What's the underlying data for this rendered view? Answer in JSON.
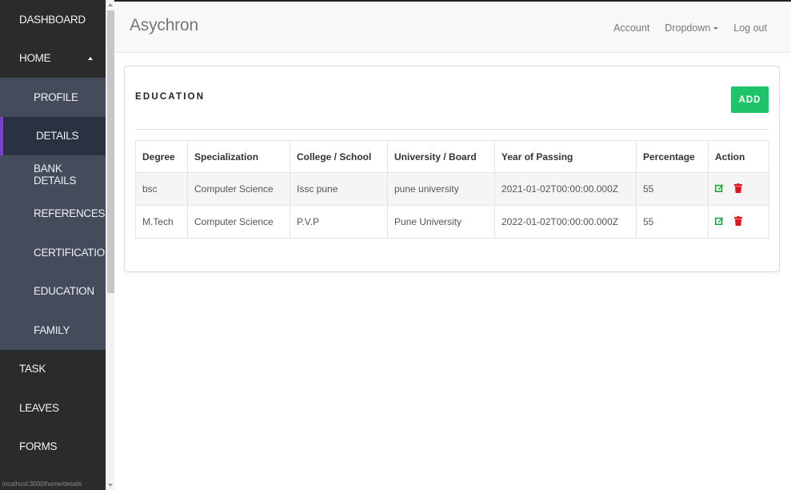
{
  "sidebar": {
    "items": [
      {
        "label": "DASHBOARD"
      },
      {
        "label": "HOME"
      },
      {
        "label": "PROFILE"
      },
      {
        "label": "DETAILS"
      },
      {
        "label": "BANK DETAILS"
      },
      {
        "label": "REFERENCES"
      },
      {
        "label": "CERTIFICATIONS"
      },
      {
        "label": "EDUCATION"
      },
      {
        "label": "FAMILY"
      },
      {
        "label": "TASK"
      },
      {
        "label": "LEAVES"
      },
      {
        "label": "FORMS"
      }
    ],
    "active_item": "DETAILS",
    "status_url": "localhost:3000/home/details"
  },
  "navbar": {
    "brand": "Asychron",
    "links": {
      "account": "Account",
      "dropdown": "Dropdown",
      "logout": "Log out"
    }
  },
  "panel": {
    "title": "EDUCATION",
    "add_label": "ADD"
  },
  "table": {
    "headers": [
      "Degree",
      "Specialization",
      "College / School",
      "University / Board",
      "Year of Passing",
      "Percentage",
      "Action"
    ],
    "rows": [
      {
        "degree": "bsc",
        "specialization": "Computer Science",
        "college": "Issc pune",
        "university": "pune university",
        "year": "2021-01-02T00:00:00.000Z",
        "percentage": "55"
      },
      {
        "degree": "M.Tech",
        "specialization": "Computer Science",
        "college": "P.V.P",
        "university": "Pune University",
        "year": "2022-01-02T00:00:00.000Z",
        "percentage": "55"
      }
    ]
  },
  "colors": {
    "sidebar_bg": "#2b2b2b",
    "submenu_bg": "#444b5a",
    "active_accent": "#7a3fd0",
    "add_button": "#1fc36a",
    "edit_icon": "#1a9e3a",
    "delete_icon": "#e0151c"
  },
  "icons": {
    "edit": "edit-icon",
    "delete": "trash-icon"
  }
}
